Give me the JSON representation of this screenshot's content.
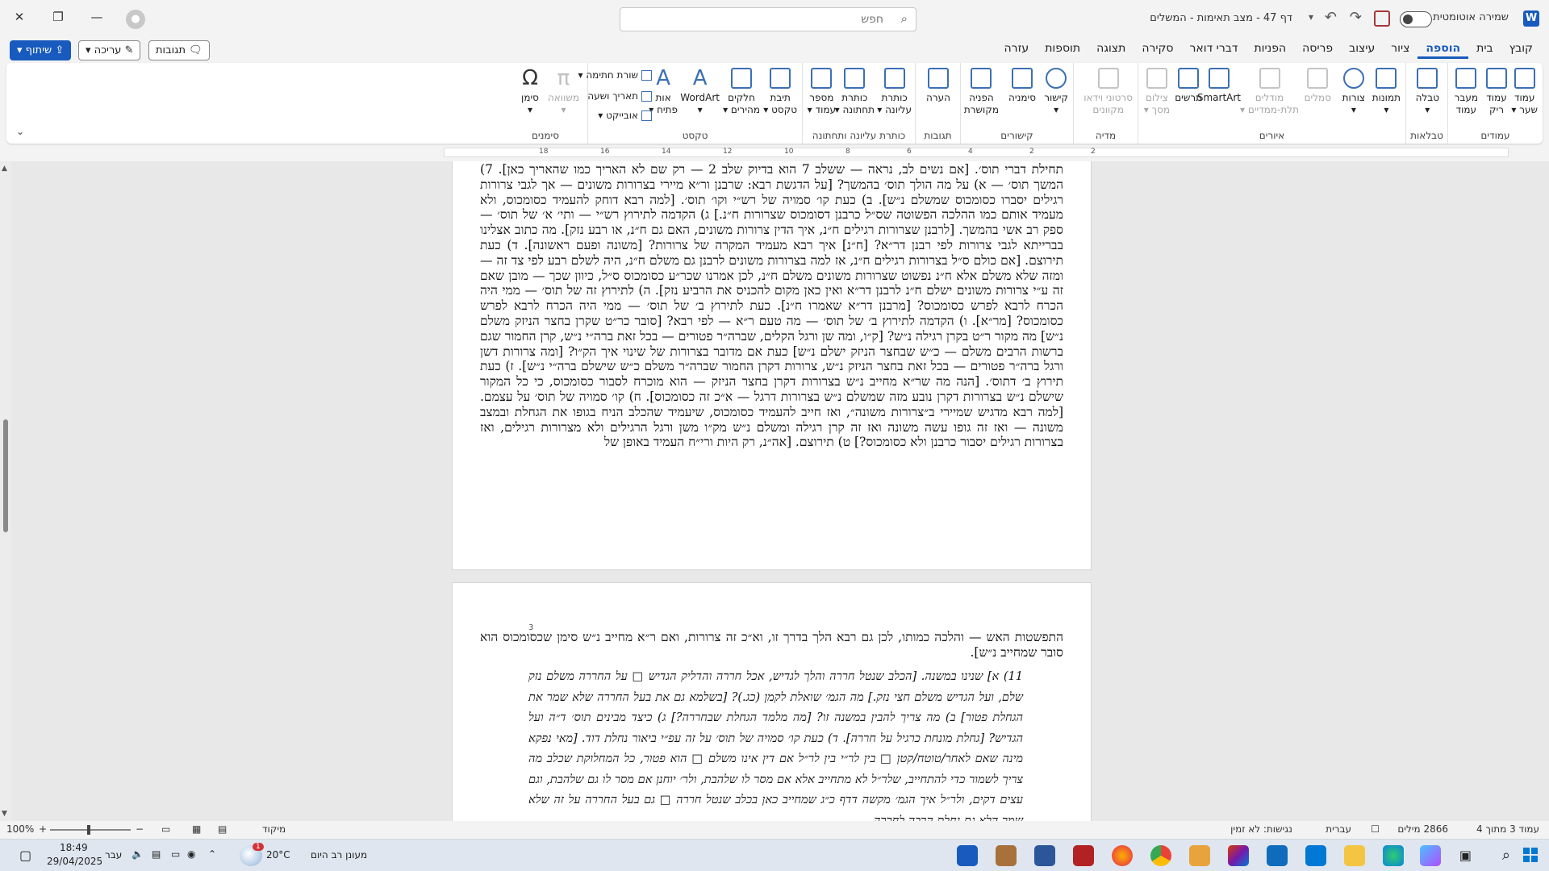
{
  "titlebar": {
    "app_icon": "W",
    "autosave_label": "שמירה אוטומטית",
    "doc_title": "דף 47 - מצב תאימות - המשלים",
    "search_placeholder": "חפש",
    "window_controls": [
      "minimize-icon",
      "restore-icon",
      "close-icon"
    ]
  },
  "tabs": [
    "קובץ",
    "בית",
    "הוספה",
    "ציור",
    "עיצוב",
    "פריסה",
    "הפניות",
    "דברי דואר",
    "סקירה",
    "תצוגה",
    "תוספות",
    "עזרה"
  ],
  "active_tab": "הוספה",
  "right_buttons": {
    "comments": "תגובות",
    "editing": "עריכה",
    "share": "שיתוף"
  },
  "ribbon": {
    "groups": {
      "pages": "עמודים",
      "tables": "טבלאות",
      "illustrations": "איורים",
      "media": "מדיה",
      "links": "קישורים",
      "comments": "תגובות",
      "header_footer": "כותרת עליונה ותחתונה",
      "text": "טקסט",
      "symbols": "סימנים"
    },
    "buttons": {
      "cover_page_1": "עמוד",
      "cover_page_2": "שער",
      "blank_page_1": "עמוד",
      "blank_page_2": "ריק",
      "page_break_1": "מעבר",
      "page_break_2": "עמוד",
      "table": "טבלה",
      "pictures": "תמונות",
      "shapes": "צורות",
      "icons": "סמלים",
      "models_1": "מודלים",
      "models_2": "תלת-ממדיים",
      "smartart": "SmartArt",
      "chart": "תרשים",
      "screenshot_1": "צילום",
      "screenshot_2": "מסך",
      "online_video_1": "סרטוני וידאו",
      "online_video_2": "מקוונים",
      "link": "קישור",
      "bookmark": "סימניה",
      "cross_ref_1": "הפניה",
      "cross_ref_2": "מקושרת",
      "comment": "הערה",
      "header_1": "כותרת",
      "header_2": "עליונה",
      "footer_1": "כותרת",
      "footer_2": "תחתונה",
      "page_number_1": "מספר",
      "page_number_2": "עמוד",
      "text_box_1": "תיבת",
      "text_box_2": "טקסט",
      "quick_parts_1": "חלקים",
      "quick_parts_2": "מהירים",
      "wordart": "WordArt",
      "drop_cap_1": "אות",
      "drop_cap_2": "פתיח",
      "signature_line": "שורת חתימה",
      "date_time": "תאריך ושעה",
      "object": "אובייקט",
      "equation": "משוואה",
      "symbol": "סימן"
    }
  },
  "ruler_numbers": [
    "18",
    "16",
    "14",
    "12",
    "10",
    "8",
    "6",
    "4",
    "2",
    "2"
  ],
  "page1_text": "תחילת דברי תוס׳. [אם נשים לב, נראה — ששלב 7 הוא בדיוק שלב 2 — רק שם לא האריך כמו שהאריך כאן]. 7) המשך תוס׳ — א) על מה הולך תוס׳ בהמשך? [על הדגשת רבא: שרבנן ור״א מיירי בצרורות משונים — אך לגבי צרורות רגילים יסברו כסומכוס שמשלם נ״ש]. ב) כעת קו׳ סמויה של רש״י וקו׳ תוס׳. [למה רבא דוחק להעמיד כסומכוס, ולא מעמיד אותם כמו ההלכה הפשוטה שס״ל כרבנן דסומכוס שצרורות ח״נ.] ג) הקדמה לתירוץ רש״י — ותי׳ א׳ של תוס׳ — ספק רב אשי בהמשך. [לרבנן שצרורות רגילים ח״נ, איך הדין צרורות משונים, האם גם ח״נ, או רבע נזק]. מה כתוב אצלינו בברייתא לגבי צרורות לפי רבנן דר״א? [ח״נ] איך רבא מעמיד המקרה של צרורות? [משונה ופעם ראשונה]. ד) כעת תירוצם. [אם כולם ס״ל בצרורות רגילים ח״נ, אז למה בצרורות משונים לרבנן גם משלם ח״נ, היה לשלם רבע לפי צד זה — ומזה שלא משלם אלא ח״נ נפשוט שצרורות משונים משלם ח״נ, לכן אמרנו שכר״ע כסומכוס ס״ל, כיוון שכך — מובן שאם זה ע״י צרורות משונים ישלם ח״נ לרבנן דר״א ואין כאן מקום להכניס את הרביע נזק]. ה) לתירוץ זה של תוס׳ — ממי היה הכרח לרבא לפרש כסומכוס? [מרבנן דר״א שאמרו ח״נ]. כעת לתירוץ ב׳ של תוס׳ — ממי היה הכרח לרבא לפרש כסומכוס? [מר״א]. ו) הקדמה לתירוץ ב׳ של תוס׳ — מה טעם ר״א — לפי רבא? [סובר כר״ט שקרן בחצר הניזק משלם נ״ש] מה מקור ר״ט בקרן רגילה נ״ש? [ק״ו, ומה שן ורגל הקלים, שברה״ר פטורים — בכל זאת ברה״י נ״ש, קרן החמור שגם ברשות הרבים משלם — כ״ש שבחצר הניזק ישלם נ״ש] כעת אם מדובר בצרורות של שינוי איך הק״ו? [ומה צרורות דשן ורגל ברה״ר פטורים — בכל זאת בחצר הניזק נ״ש, צרורות דקרן החמור שברה״ר משלם כ״ש שישלם ברה״י נ״ש]. ז) כעת תירוץ ב׳ דתוס׳. [הנה מה שר״א מחייב נ״ש בצרורות דקרן בחצר הניזק — הוא מוכרח לסבור כסומכוס, כי כל המקור שישלם נ״ש בצרורות דקרן נובע מזה שמשלם נ״ש בצרורות דרגל — א״כ זה כסומכוס]. ח) קו׳ סמויה של תוס׳ על עצמם. [למה רבא מדגיש שמיירי ב״צרורות משונה״, ואז חייב להעמיד כסומכוס, שיעמיד שהכלב הניח בגופו את הגחלת ובמצב משונה — ואז זה גופו עשה משונה ואז זה קרן רגילה ומשלם נ״ש מק״ו משן ורגל הרגילים ולא מצרורות רגילים, ואז בצרורות רגילים יסבור כרבנן ולא כסומכוס?] ט) תירוצם. [אה״נ, רק היות ורי״ח העמיד באופן של",
  "page2_text_top": "התפשטות האש — והלכה כמותו, לכן גם רבא הלך בדרך זו, וא״כ זה צרורות, ואם ר״א מחייב נ״ש סימן שכסומכוס הוא סובר שמחייב נ״ש].",
  "page2_footnote_number": "3",
  "page2_text_body": "11) א] שנינו במשנה. [הכלב שנטל חררה והלך לגדיש, אכל חררה והדליק הגדיש □ על החררה משלם נזק שלם, ועל הגדיש משלם חצי נזק.] מה הגמ׳ שואלת לקמן (כג.)? [בשלמא גם את בעל החררה שלא שמר את הגחלת פטור] ב) מה צריך להבין במשנה זו? [מה מלמד הגחלת שבחררה?] ג) כיצד מבינים תוס׳ ד״ה ועל הגדיש? [גחלת מונחת כרגיל על חררה]. ד) כעת קו׳ סמויה של תוס׳ על זה עפ״י ביאור נחלת דוד. [מאי נפקא מינה שאם לאחר/טוטח/קטן □ בין לר״י בין לר״ל אם דין אינו משלם □ הוא פטור, כל המחלוקת שכלב מה צריך לשמור כדי להתחייב, שלר״ל לא מתחייב אלא אם מסר לו שלהבת, ולר׳ יוחנן אם מסר לו גם שלהבת, וגם עצים דקים, ולר״ל איך הגמ׳ מקשה דדף כ״ג שמחייב כאן בכלב שנטל חררה □ גם בעל החררה על זה שלא שמר הלא גם נחלת הרבה לחררה...",
  "statusbar": {
    "page": "עמוד 3 מתוך 4",
    "words": "2866 מילים",
    "language": "עברית",
    "accessibility": "נגישות: לא זמין",
    "focus": "מיקוד",
    "zoom": "100%"
  },
  "taskbar": {
    "weather_temp": "20°C",
    "weather_desc": "מעונן רב היום",
    "time": "18:49",
    "date": "29/04/2025",
    "input_lang": "עבר",
    "weather_badge": "1"
  },
  "colors": {
    "accent": "#185abd",
    "save_red": "#a4373a",
    "ribbon_icon": "#3c6fb5"
  }
}
